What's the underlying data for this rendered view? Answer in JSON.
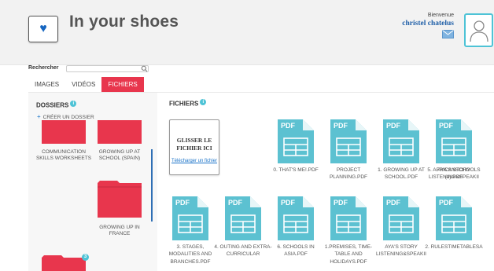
{
  "header": {
    "app_title": "In your shoes",
    "welcome": "Bienvenue",
    "username": "christel chatelus"
  },
  "search": {
    "label": "Rechercher",
    "value": "",
    "placeholder": ""
  },
  "tabs": [
    {
      "label": "IMAGES",
      "active": false
    },
    {
      "label": "VIDÉOS",
      "active": false
    },
    {
      "label": "FICHIERS",
      "active": true
    }
  ],
  "dossiers": {
    "title": "DOSSIERS",
    "create_label": "CRÉER UN DOSSIER",
    "folders": [
      {
        "label": "COMMUNICATION SKILLS WORKSHEETS"
      },
      {
        "label": "GROWING UP AT SCHOOL (SPAIN)"
      },
      {
        "label": "GROWING UP IN FRANCE"
      },
      {
        "label": "",
        "badge": "3"
      }
    ]
  },
  "fichiers": {
    "title": "FICHIERS",
    "dropzone_title": "GLISSER LE FICHIER ICI",
    "dropzone_link": "Télécharger un fichier",
    "pdf_badge": "PDF",
    "files": [
      {
        "name": "0. THAT'S ME!.PDF"
      },
      {
        "name": "PROJECT PLANNING.PDF"
      },
      {
        "name": "1. GROWING UP AT SCHOOL.PDF"
      },
      {
        "name": "AYA'S STORY LISTENING&SPEAKII"
      },
      {
        "name": "5. AFRICANSCHOOLS (a).PDF"
      },
      {
        "name": "3. STAGES, MODALITIES AND BRANCHES.PDF"
      },
      {
        "name": "4. OUTING AND EXTRA-CURRICULAR"
      },
      {
        "name": "6. SCHOOLS IN ASIA.PDF"
      },
      {
        "name": "1.PREMISES, TIME-TABLE AND HOLIDAYS.PDF"
      },
      {
        "name": "AYA'S STORY LISTENING&SPEAKII"
      },
      {
        "name": "2. RULESTIMETABLESA"
      }
    ]
  },
  "colors": {
    "accent_red": "#e8364d",
    "file_teal": "#5cc1d1",
    "link_blue": "#1a73c8"
  },
  "icons": {
    "logo": "heart-icon",
    "mail": "mail-icon",
    "avatar": "user-avatar-icon",
    "search": "search-icon",
    "info": "info-icon",
    "pdf": "pdf-file-icon"
  }
}
